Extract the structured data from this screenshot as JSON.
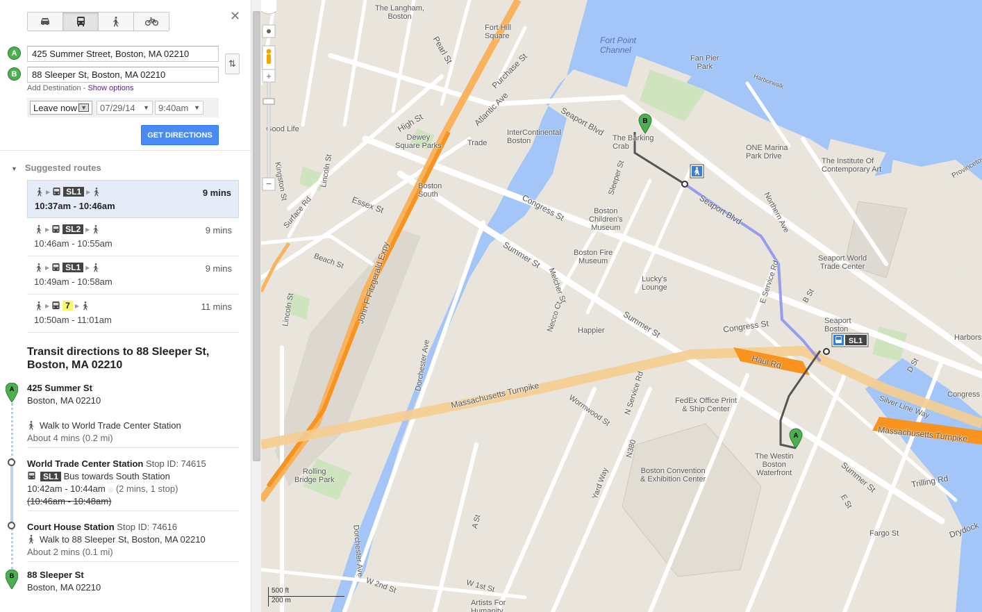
{
  "directions": {
    "modes": [
      {
        "name": "driving",
        "active": false
      },
      {
        "name": "transit",
        "active": true
      },
      {
        "name": "walking",
        "active": false
      },
      {
        "name": "bicycling",
        "active": false
      }
    ],
    "origin": {
      "marker": "A",
      "value": "425 Summer Street, Boston, MA 02210"
    },
    "destination": {
      "marker": "B",
      "value": "88 Sleeper St, Boston, MA 02210"
    },
    "add_destination": "Add Destination",
    "separator": " - ",
    "show_options": "Show options",
    "leave_option": "Leave now",
    "date": "07/29/14",
    "time": "9:40am",
    "get_directions": "GET DIRECTIONS",
    "close": "✕",
    "swap": "⇅"
  },
  "suggested": {
    "title": "Suggested routes",
    "routes": [
      {
        "line": "SL1",
        "times": "10:37am - 10:46am",
        "duration": "9 mins",
        "selected": true
      },
      {
        "line": "SL2",
        "times": "10:46am - 10:55am",
        "duration": "9 mins",
        "selected": false
      },
      {
        "line": "SL1",
        "times": "10:49am - 10:58am",
        "duration": "9 mins",
        "selected": false
      },
      {
        "line": "7",
        "times": "10:50am - 11:01am",
        "duration": "11 mins",
        "selected": false
      }
    ]
  },
  "transit": {
    "title": "Transit directions to 88 Sleeper St, Boston, MA 02210",
    "start": {
      "name": "425 Summer St",
      "city": "Boston, MA 02210"
    },
    "walk1": {
      "text": "Walk to World Trade Center Station",
      "about": "About 4 mins (0.2 mi)"
    },
    "stop1": {
      "name": "World Trade Center Station",
      "stopid": "Stop ID: 74615"
    },
    "bus": {
      "line": "SL1",
      "text": "Bus towards South Station",
      "times": "10:42am - 10:44am",
      "extra": "(2 mins, 1 stop)",
      "old_times": "(10:46am - 10:48am)"
    },
    "stop2": {
      "name": "Court House Station",
      "stopid": "Stop ID: 74616"
    },
    "walk2": {
      "text": "Walk to 88 Sleeper St, Boston, MA 02210",
      "about": "About 2 mins (0.1 mi)"
    },
    "end": {
      "name": "88 Sleeper St",
      "city": "Boston, MA 02210"
    }
  },
  "map": {
    "labels": {
      "fort_point": "Fort Point\nChannel",
      "fan_pier": "Fan Pier\nPark",
      "harborwalk": "Harborwalk",
      "seaport_blvd": "Seaport Blvd",
      "barking_crab": "The Barking\nCrab",
      "one_marina": "ONE Marina\nPark Drive",
      "ica": "The Institute Of\nContemporary Art",
      "intercontinental": "InterContinental\nBoston",
      "dewey": "Dewey\nSquare Parks",
      "boston_south": "Boston\nSouth",
      "congress_st": "Congress St",
      "summer_st": "Summer St",
      "childrens": "Boston\nChildren's\nMuseum",
      "fire_museum": "Boston Fire\nMuseum",
      "luckys": "Lucky's\nLounge",
      "seaport_wtc": "Seaport World\nTrade Center",
      "seaport_boston": "Seaport\nBoston",
      "happier": "Happier",
      "fedex": "FedEx Office Print\n& Ship Center",
      "westin": "The Westin\nBoston\nWaterfront",
      "bcec": "Boston Convention\n& Exhibition Center",
      "mass_pike": "Massachusetts Turnpike",
      "mass_pike2": "Massachusetts Turnpike",
      "rolling_bridge": "Rolling\nBridge Park",
      "haul_rd": "Haul Rd",
      "silver_line": "Silver Line Way",
      "trilling": "Trilling Rd",
      "drydock": "Drydock",
      "fargo": "Fargo St",
      "langham": "The Langham,\nBoston",
      "fort_hill": "Fort Hill\nSquare",
      "good_life": "Good Life",
      "trade": "Trade",
      "n_service": "N Service Rd",
      "e_service": "E Service Rd",
      "northern_ave": "Northern Ave",
      "sleeper_st": "Sleeper St",
      "ne_ave": "Necco Ct",
      "melcher": "Melcher St",
      "dorchester": "Dorchester Ave",
      "essex": "Essex St",
      "purchase": "Purchase St",
      "atlantic": "Atlantic Ave",
      "pearl": "Pearl St",
      "high": "High St",
      "lincoln": "Lincoln St",
      "surface": "Surface Rd",
      "kingston": "Kingston St",
      "beach": "Beach St",
      "expy": "John F Fitzgerald Expy",
      "congress_w": "Congress",
      "provincetown": "Provincetow",
      "harbors": "Harbors",
      "d_st": "D St",
      "b_st": "B St",
      "a_st": "A St",
      "e_st": "E St",
      "w2nd": "W 2nd St",
      "w1st": "W 1st St",
      "artists": "Artists For\nHumanity",
      "wormwood": "Wormwood St",
      "yard_way": "Yard Way",
      "n380": "N380",
      "scale_ft": "500 ft",
      "scale_m": "200 m",
      "route_sl1": "SL1",
      "pin_a": "A",
      "pin_b": "B"
    }
  }
}
